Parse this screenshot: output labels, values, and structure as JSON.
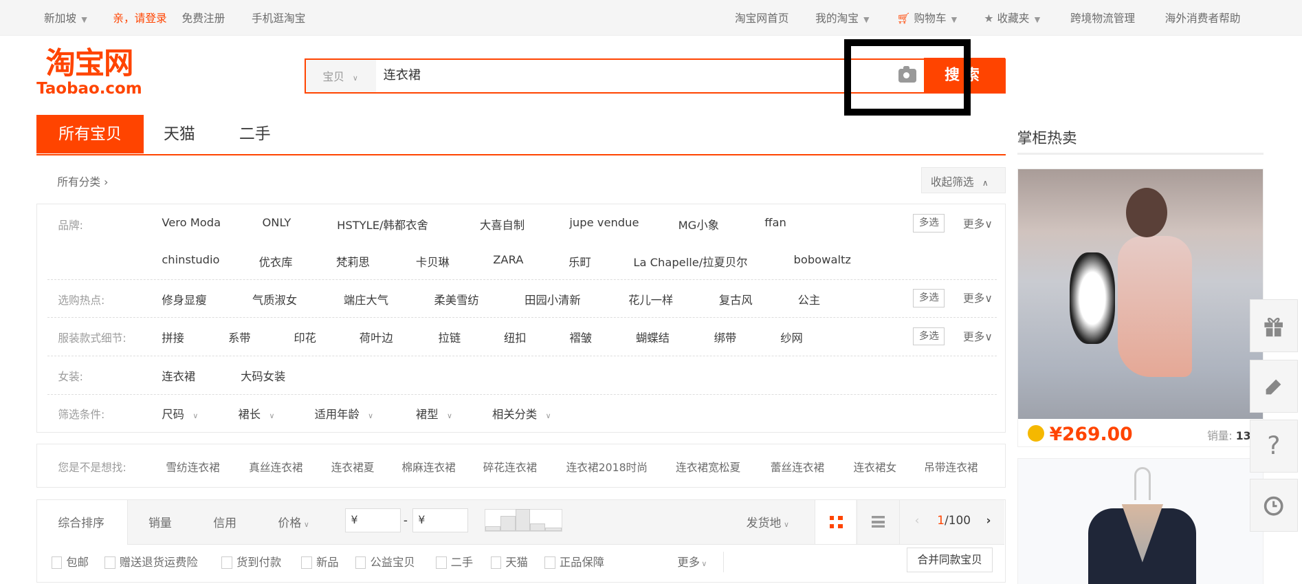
{
  "topbar": {
    "region": "新加坡",
    "login": "亲，请登录",
    "register": "免费注册",
    "mobile": "手机逛淘宝",
    "home": "淘宝网首页",
    "my_taobao": "我的淘宝",
    "cart": "购物车",
    "favorites": "收藏夹",
    "logistics": "跨境物流管理",
    "help": "海外消费者帮助"
  },
  "logo": {
    "cn": "淘宝网",
    "en": "Taobao.com"
  },
  "search": {
    "category": "宝贝",
    "query": "连衣裙",
    "button": "搜索"
  },
  "tabs": [
    "所有宝贝",
    "天猫",
    "二手"
  ],
  "breadcrumb": "所有分类",
  "collapse_label": "收起筛选",
  "filters": {
    "multi_label": "多选",
    "more_label": "更多",
    "brand": {
      "label": "品牌:",
      "row1": [
        "Vero Moda",
        "ONLY",
        "HSTYLE/韩都衣舍",
        "大喜自制",
        "jupe vendue",
        "MG小象",
        "ffan"
      ],
      "row2": [
        "chinstudio",
        "优衣库",
        "梵莉思",
        "卡贝琳",
        "ZARA",
        "乐町",
        "La Chapelle/拉夏贝尔",
        "bobowaltz"
      ]
    },
    "hot": {
      "label": "选购热点:",
      "items": [
        "修身显瘦",
        "气质淑女",
        "端庄大气",
        "柔美雪纺",
        "田园小清新",
        "花儿一样",
        "复古风",
        "公主"
      ]
    },
    "detail": {
      "label": "服装款式细节:",
      "items": [
        "拼接",
        "系带",
        "印花",
        "荷叶边",
        "拉链",
        "纽扣",
        "褶皱",
        "蝴蝶结",
        "绑带",
        "纱网"
      ]
    },
    "women": {
      "label": "女装:",
      "items": [
        "连衣裙",
        "大码女装"
      ]
    },
    "conditions": {
      "label": "筛选条件:",
      "items": [
        "尺码",
        "裙长",
        "适用年龄",
        "裙型",
        "相关分类"
      ]
    }
  },
  "suggest": {
    "label": "您是不是想找:",
    "items": [
      "雪纺连衣裙",
      "真丝连衣裙",
      "连衣裙夏",
      "棉麻连衣裙",
      "碎花连衣裙",
      "连衣裙2018时尚",
      "连衣裙宽松夏",
      "蕾丝连衣裙",
      "连衣裙女",
      "吊带连衣裙"
    ]
  },
  "sort": {
    "items": [
      "综合排序",
      "销量",
      "信用",
      "价格"
    ],
    "price_from": "¥",
    "price_to": "¥",
    "price_dash": "-",
    "ship_from": "发货地",
    "page_current": "1",
    "page_total": "/100",
    "checkboxes": [
      "包邮",
      "赠送退货运费险",
      "货到付款",
      "新品",
      "公益宝贝",
      "二手",
      "天猫",
      "正品保障"
    ],
    "more": "更多",
    "merge": "合并同款宝贝"
  },
  "side": {
    "title": "掌柜热卖",
    "product1": {
      "price": "¥269.00",
      "sales_label": "销量:",
      "sales_value": "13"
    }
  },
  "colors": {
    "accent": "#ff4400"
  }
}
